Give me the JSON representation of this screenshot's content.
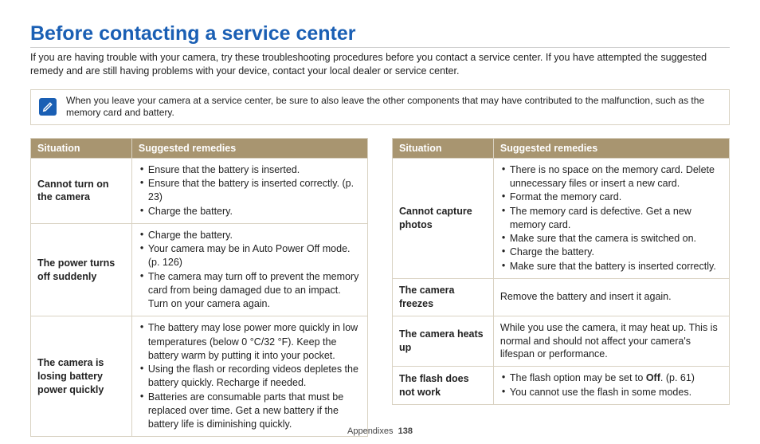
{
  "title": "Before contacting a service center",
  "intro": "If you are having trouble with your camera, try these troubleshooting procedures before you contact a service center. If you have attempted the suggested remedy and are still having problems with your device, contact your local dealer or service center.",
  "note": "When you leave your camera at a service center, be sure to also leave the other components that may have contributed to the malfunction, such as the memory card and battery.",
  "headers": {
    "situation": "Situation",
    "remedies": "Suggested remedies"
  },
  "left_rows": [
    {
      "situation": "Cannot turn on the camera",
      "remedies": [
        "Ensure that the battery is inserted.",
        "Ensure that the battery is inserted correctly. (p. 23)",
        "Charge the battery."
      ],
      "type": "list"
    },
    {
      "situation": "The power turns off suddenly",
      "remedies": [
        "Charge the battery.",
        "Your camera may be in Auto Power Off mode. (p. 126)",
        "The camera may turn off to prevent the memory card from being damaged due to an impact. Turn on your camera again."
      ],
      "type": "list"
    },
    {
      "situation": "The camera is losing battery power quickly",
      "remedies": [
        "The battery may lose power more quickly in low temperatures (below 0 °C/32 °F). Keep the battery warm by putting it into your pocket.",
        "Using the flash or recording videos depletes the battery quickly. Recharge if needed.",
        "Batteries are consumable parts that must be replaced over time. Get a new battery if the battery life is diminishing quickly."
      ],
      "type": "list"
    }
  ],
  "right_rows": [
    {
      "situation": "Cannot capture photos",
      "remedies": [
        "There is no space on the memory card. Delete unnecessary files or insert a new card.",
        "Format the memory card.",
        "The memory card is defective. Get a new memory card.",
        "Make sure that the camera is switched on.",
        "Charge the battery.",
        "Make sure that the battery is inserted correctly."
      ],
      "type": "list"
    },
    {
      "situation": "The camera freezes",
      "remedies_plain": "Remove the battery and insert it again.",
      "type": "plain"
    },
    {
      "situation": "The camera heats up",
      "remedies_plain": "While you use the camera, it may heat up. This is normal and should not affect your camera's lifespan or performance.",
      "type": "plain"
    },
    {
      "situation": "The flash does not work",
      "remedies_html": [
        {
          "pre": "The flash option may be set to ",
          "bold": "Off",
          "post": ". (p. 61)"
        },
        {
          "pre": "You cannot use the flash in some modes.",
          "bold": "",
          "post": ""
        }
      ],
      "type": "html-list"
    }
  ],
  "footer": {
    "section": "Appendixes",
    "page": "138"
  }
}
